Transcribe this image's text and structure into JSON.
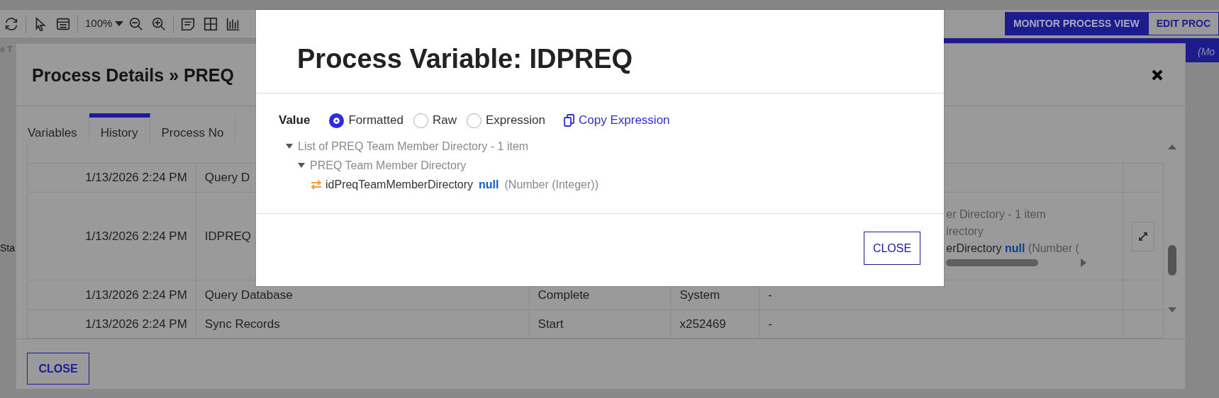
{
  "toolbar": {
    "zoom": "100%",
    "view_buttons": [
      {
        "label": "MONITOR PROCESS VIEW",
        "selected": true
      },
      {
        "label": "EDIT PROC",
        "selected": false
      }
    ]
  },
  "background_fragments": {
    "header": "e T",
    "subheader": "(Mo",
    "side": "Sta"
  },
  "process_details": {
    "title": "Process Details » PREQ",
    "tabs": [
      {
        "label": "Variables",
        "selected": false
      },
      {
        "label": "History",
        "selected": true
      },
      {
        "label": "Process No",
        "selected": false
      }
    ],
    "rows": [
      {
        "time": "1/13/2026 2:24 PM",
        "step": "Query D"
      },
      {
        "time": "1/13/2026 2:24 PM",
        "step": "IDPREQ",
        "preview": {
          "lines": [
            "er Directory - 1 item",
            "irectory"
          ],
          "field": {
            "name": "erDirectory",
            "value": "null",
            "type": "(Number ("
          }
        }
      },
      {
        "time": "1/13/2026 2:24 PM",
        "step": "Query Database",
        "status": "Complete",
        "user": "System",
        "detail": "-"
      },
      {
        "time": "1/13/2026 2:24 PM",
        "step": "Sync Records",
        "status": "Start",
        "user": "x252469",
        "detail": "-"
      }
    ],
    "close_button": "CLOSE"
  },
  "variable_dialog": {
    "title": "Process Variable: IDPREQ",
    "value_label": "Value",
    "modes": [
      {
        "label": "Formatted",
        "selected": true
      },
      {
        "label": "Raw",
        "selected": false
      },
      {
        "label": "Expression",
        "selected": false
      }
    ],
    "copy_link": "Copy Expression",
    "tree": [
      {
        "label": "List of PREQ Team Member Directory - 1 item",
        "expanded": true,
        "children": [
          {
            "label": "PREQ Team Member Directory",
            "expanded": true,
            "children": [
              {
                "kind": "field",
                "name": "idPreqTeamMemberDirectory",
                "value": "null",
                "type": "(Number (Integer))"
              }
            ]
          }
        ]
      }
    ],
    "close_button": "CLOSE"
  }
}
